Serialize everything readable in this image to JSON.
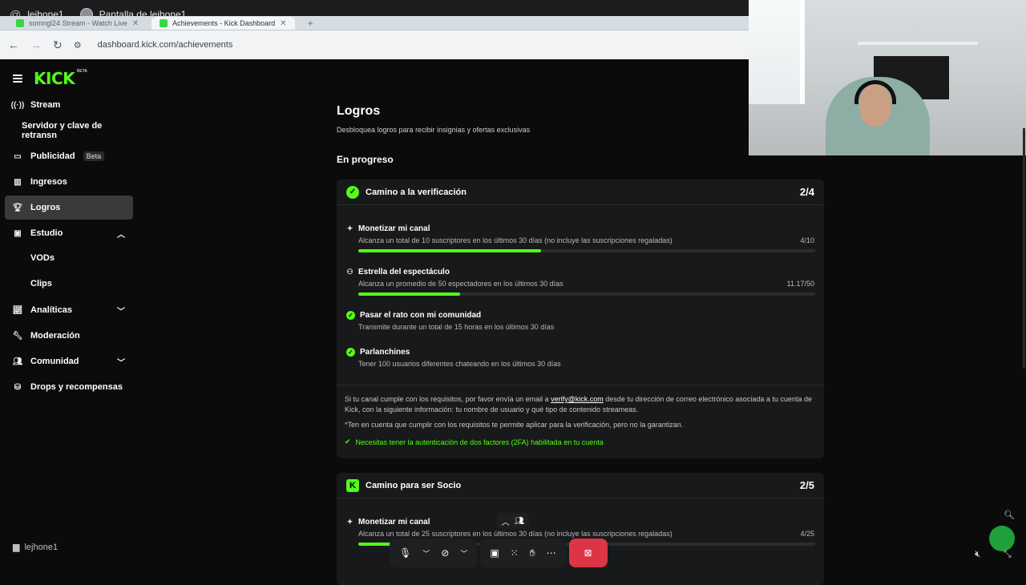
{
  "share_bar": {
    "user": "lejhone1",
    "screen_label": "Pantalla de lejhone1"
  },
  "browser": {
    "tabs": [
      {
        "label": "somngl24 Stream - Watch Live",
        "active": false
      },
      {
        "label": "Achievements - Kick Dashboard",
        "active": true
      }
    ],
    "url": "dashboard.kick.com/achievements"
  },
  "sidebar": {
    "logo": "KICK",
    "logo_tag": "BETA",
    "items": [
      {
        "label": "Stream",
        "icon": "broadcast-icon"
      },
      {
        "label": "Servidor y clave de retransn",
        "icon": ""
      },
      {
        "label": "Publicidad",
        "icon": "ads-icon",
        "badge": "Beta"
      },
      {
        "label": "Ingresos",
        "icon": "revenue-icon"
      },
      {
        "label": "Logros",
        "icon": "trophy-icon",
        "active": true
      },
      {
        "label": "Estudio",
        "icon": "studio-icon",
        "expanded": true
      },
      {
        "label": "VODs"
      },
      {
        "label": "Clips"
      },
      {
        "label": "Analíticas",
        "icon": "analytics-icon"
      },
      {
        "label": "Moderación",
        "icon": "wrench-icon"
      },
      {
        "label": "Comunidad",
        "icon": "community-icon"
      },
      {
        "label": "Drops y recompensas",
        "icon": "drops-icon"
      }
    ],
    "username": "lejhone1"
  },
  "main": {
    "title": "Logros",
    "subtitle": "Desbloquea logros para recibir insignias y ofertas exclusivas",
    "section": "En progreso",
    "card1": {
      "title": "Camino a la verificación",
      "count": "2/4",
      "achievements": [
        {
          "title": "Monetizar mi canal",
          "desc": "Alcanza un total de 10 suscriptores en los últimos 30 días (no incluye las suscripciones regaladas)",
          "progress": "4/10",
          "fraction": 0.4
        },
        {
          "title": "Estrella del espectáculo",
          "desc": "Alcanza un promedio de 50 espectadores en los últimos 30 días",
          "progress": "11.17/50",
          "fraction": 0.223
        },
        {
          "title": "Pasar el rato con mi comunidad",
          "desc": "Transmite durante un total de 15 horas en los últimos 30 días",
          "done": true
        },
        {
          "title": "Parlanchines",
          "desc": "Tener 100 usuarios diferentes chateando en los últimos 30 días",
          "done": true
        }
      ],
      "note_pre": "Si tu canal cumple con los requisitos, por favor envía un email a ",
      "note_link": "verify@kick.com",
      "note_post": " desde tu dirección de correo electrónico asociada a tu cuenta de Kick, con la siguiente información: tu nombre de usuario y qué tipo de contenido streameas.",
      "disclaimer": "*Ten en cuenta que cumplir con los requisitos te permite aplicar para la verificación, pero no la garantizan.",
      "twofa": "Necesitas tener la autenticación de dos factores (2FA) habilitada en tu cuenta"
    },
    "card2": {
      "title": "Camino para ser Socio",
      "count": "2/5",
      "achievements": [
        {
          "title": "Monetizar mi canal",
          "desc": "Alcanza un total de 25 suscriptores en los últimos 30 días (no incluye las suscripciones regaladas)",
          "progress": "4/25",
          "fraction": 0.16
        }
      ]
    }
  },
  "colors": {
    "accent": "#53fc18",
    "stop": "#dc3545",
    "background": "#0b0b0c",
    "card": "#18191b"
  }
}
